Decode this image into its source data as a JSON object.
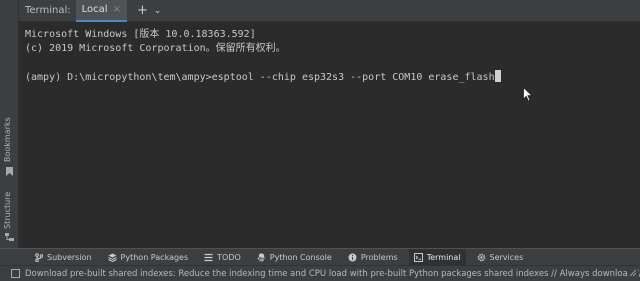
{
  "terminal_header": {
    "title": "Terminal:",
    "tab_label": "Local",
    "tab_close": "×",
    "new_tab": "+",
    "dropdown": "⌄"
  },
  "left_stripe": {
    "bookmarks": "Bookmarks",
    "structure": "Structure"
  },
  "terminal": {
    "lines": [
      "Microsoft Windows [版本 10.0.18363.592]",
      "(c) 2019 Microsoft Corporation。保留所有权利。",
      "",
      "(ampy) D:\\micropython\\tem\\ampy>esptool --chip esp32s3 --port COM10 erase_flash"
    ]
  },
  "tool_windows": [
    {
      "label": "Subversion",
      "icon": "branch-icon"
    },
    {
      "label": "Python Packages",
      "icon": "layers-icon"
    },
    {
      "label": "TODO",
      "icon": "list-icon"
    },
    {
      "label": "Python Console",
      "icon": "python-icon"
    },
    {
      "label": "Problems",
      "icon": "info-icon"
    },
    {
      "label": "Terminal",
      "icon": "terminal-icon",
      "active": true
    },
    {
      "label": "Services",
      "icon": "gear-icon"
    }
  ],
  "status_bar": {
    "message": "Download pre-built shared indexes: Reduce the indexing time and CPU load with pre-built Python packages shared indexes // Always download // Download once"
  }
}
